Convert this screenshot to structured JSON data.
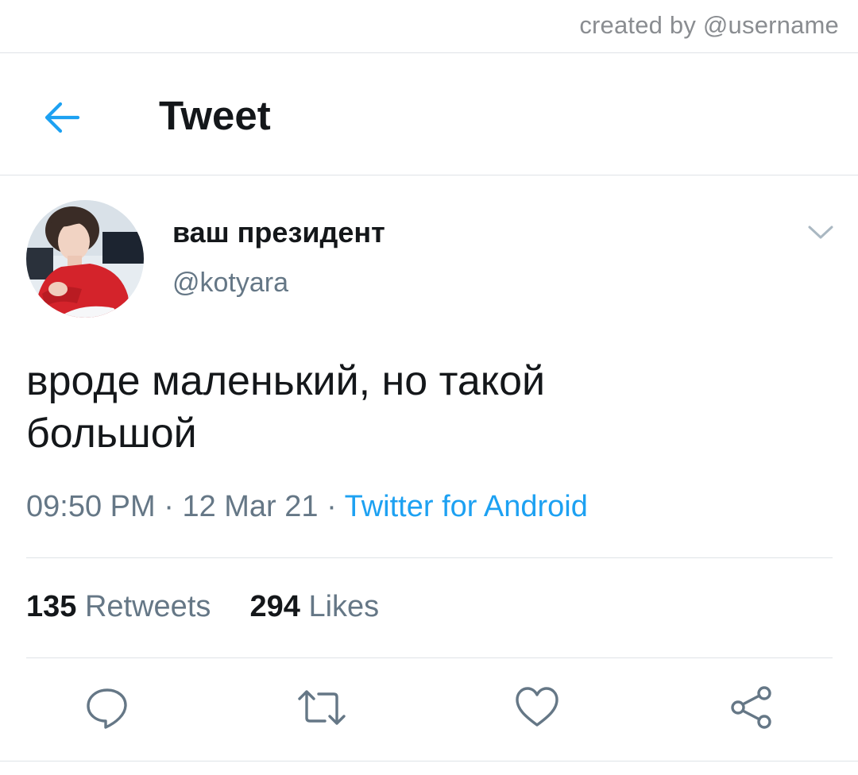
{
  "credit": "created by @username",
  "header": {
    "title": "Tweet",
    "back_icon": "arrow-left-icon"
  },
  "tweet": {
    "author": {
      "display_name": "ваш президент",
      "handle": "@kotyara"
    },
    "text_line1": "вроде маленький, но такой",
    "text_line2": "большой",
    "time": "09:50 PM",
    "separator": " · ",
    "date": "12 Mar 21",
    "source": "Twitter for Android",
    "retweets": {
      "count": "135",
      "label": "Retweets"
    },
    "likes": {
      "count": "294",
      "label": "Likes"
    }
  },
  "actions": [
    "reply-icon",
    "retweet-icon",
    "like-icon",
    "share-icon"
  ],
  "colors": {
    "accent": "#1da1f2",
    "text": "#14171a",
    "secondary": "#657786",
    "divider": "#dfe3e7"
  }
}
